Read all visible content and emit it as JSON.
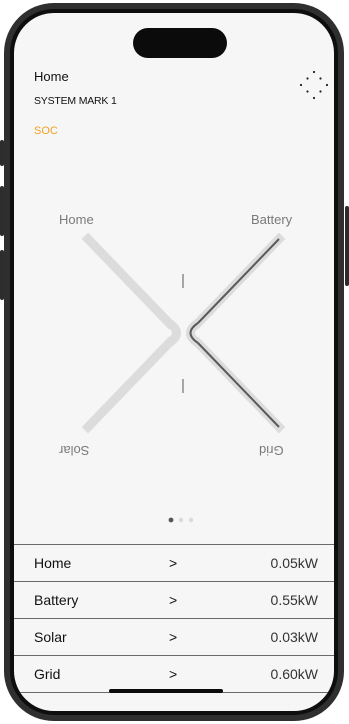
{
  "header": {
    "title": "Home",
    "subtitle": "SYSTEM MARK 1",
    "soc_label": "SOC"
  },
  "flow": {
    "labels": {
      "home": "Home",
      "battery": "Battery",
      "solar": "Solar",
      "grid": "Grid"
    }
  },
  "pager": {
    "pages": 3,
    "active": 1
  },
  "table": {
    "rows": [
      {
        "name": "Home",
        "arrow": ">",
        "value": "0.05kW"
      },
      {
        "name": "Battery",
        "arrow": ">",
        "value": "0.55kW"
      },
      {
        "name": "Solar",
        "arrow": ">",
        "value": "0.03kW"
      },
      {
        "name": "Grid",
        "arrow": ">",
        "value": "0.60kW"
      }
    ]
  },
  "colors": {
    "accent": "#f0a122",
    "flow_inactive": "#dcdcdc",
    "flow_active": "#5a5a5a"
  },
  "icons": {
    "menu": "menu-dots-icon"
  }
}
